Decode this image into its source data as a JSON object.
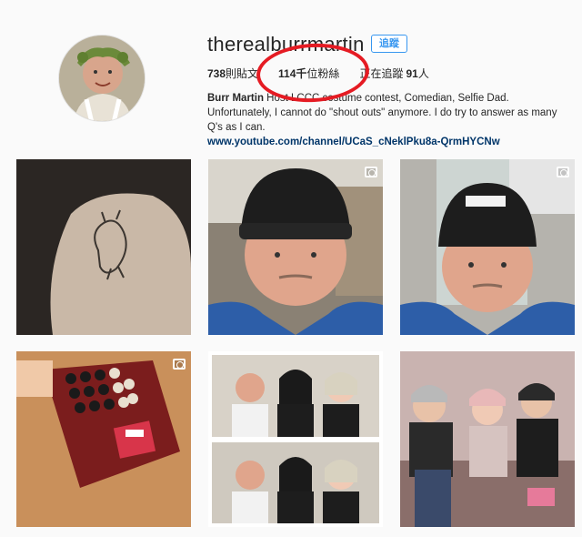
{
  "profile": {
    "username": "therealburrmartin",
    "follow_label": "追蹤",
    "posts_count": "738",
    "posts_label": "則貼文",
    "followers_count": "114千",
    "followers_label": "位粉絲",
    "following_label": "正在追蹤",
    "following_count": "91",
    "following_unit": "人",
    "bio_name": "Burr Martin",
    "bio_text": " Host LCCC costume contest, Comedian, Selfie Dad. Unfortunately, I cannot do \"shout outs\" anymore. I do try to answer as many Q's as I can.",
    "bio_link": "www.youtube.com/channel/UCaS_cNeklPku8a-QrmHYCNw"
  },
  "posts": [
    {
      "name": "post-tattoo",
      "type": "photo"
    },
    {
      "name": "post-selfie-beanie",
      "type": "video"
    },
    {
      "name": "post-selfie-station",
      "type": "video"
    },
    {
      "name": "post-candy-box",
      "type": "video"
    },
    {
      "name": "post-group-collage",
      "type": "photo"
    },
    {
      "name": "post-couch-friends",
      "type": "photo"
    }
  ],
  "colors": {
    "follow_blue": "#3897f0",
    "annotation_red": "#e51b23"
  }
}
